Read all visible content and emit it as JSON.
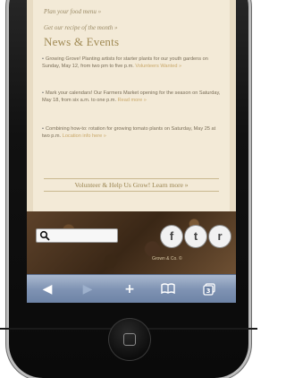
{
  "page": {
    "link_produce": "Plan your food menu »",
    "link_recipe": "Get our recipe of the month »",
    "news_title": "News & Events",
    "news": [
      {
        "text": "Growing Grove! Planting artists for starter plants for our youth gardens on Sunday, May 12, from two pm to five p.m.",
        "more": "Volunteers Wanted »"
      },
      {
        "text": "Mark your calendars! Our Farmers Market opening for the season on Saturday, May 18, from six a.m. to one p.m.",
        "more": "Read more »"
      },
      {
        "text": "Combining how-to: rotation for growing tomato plants on Saturday, May 25 at two p.m.",
        "more": "Location info here »"
      }
    ],
    "volunteer_label": "Volunteer & Help Us Grow! Learn more »"
  },
  "footer": {
    "search_placeholder": "",
    "footnote": "Grown & Co. ©",
    "social": [
      {
        "name": "facebook",
        "glyph": "f"
      },
      {
        "name": "twitter",
        "glyph": "t"
      },
      {
        "name": "rss",
        "glyph": "r"
      }
    ]
  },
  "toolbar": {
    "back": "◀",
    "forward": "▶",
    "add": "+",
    "tabs_count": "3"
  },
  "colors": {
    "toolbar": "#7f93b3",
    "accent": "#a08a54"
  }
}
